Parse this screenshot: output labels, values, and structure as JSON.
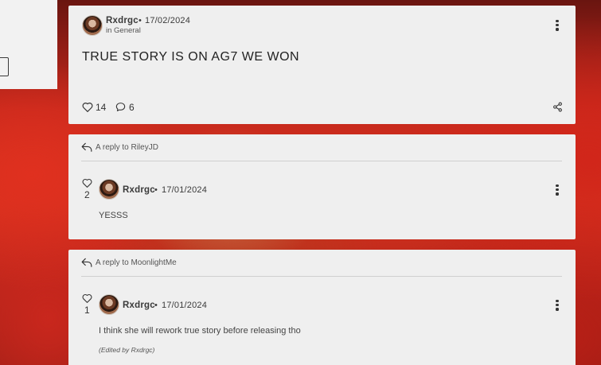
{
  "post": {
    "author": "Rxdrgc",
    "separator": "•",
    "date": "17/02/2024",
    "category": "in General",
    "title": "TRUE STORY IS ON AG7 WE WON",
    "likes": "14",
    "comments": "6"
  },
  "replies": [
    {
      "reply_to": "A reply to RileyJD",
      "likes": "2",
      "author": "Rxdrgc",
      "separator": "•",
      "date": "17/01/2024",
      "text": "YESSS"
    },
    {
      "reply_to": "A reply to MoonlightMe",
      "likes": "1",
      "author": "Rxdrgc",
      "separator": "•",
      "date": "17/01/2024",
      "text": "I think she will rework true story before releasing tho",
      "edited": "(Edited by Rxdrgc)"
    }
  ],
  "icons": {
    "like": "heart-icon",
    "comment": "comment-icon",
    "share": "share-icon",
    "more": "more-options-icon",
    "reply": "reply-arrow-icon"
  }
}
